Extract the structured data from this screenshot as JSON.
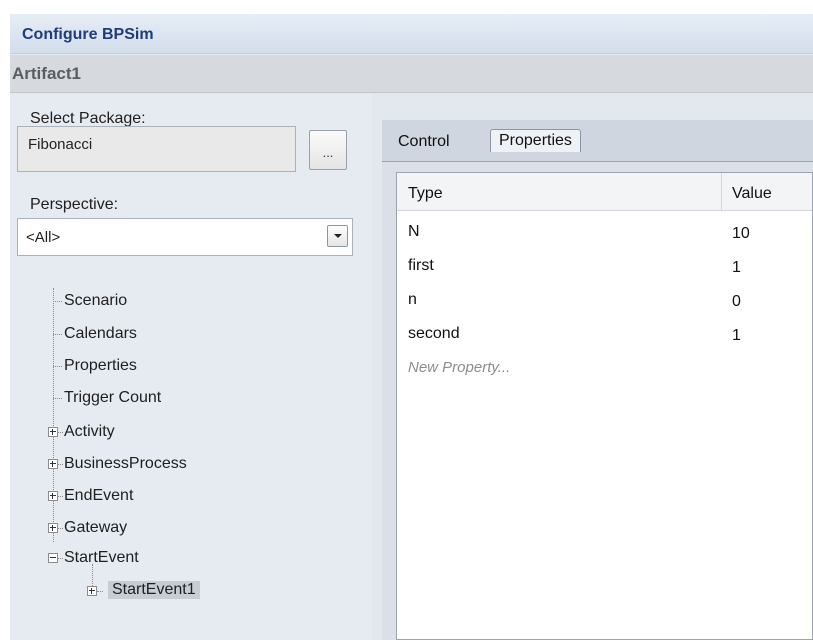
{
  "window": {
    "title": "Configure BPSim",
    "subtitle": "Artifact1"
  },
  "left": {
    "select_package_label": "Select Package:",
    "package_value": "Fibonacci",
    "browse_label": "...",
    "perspective_label": "Perspective:",
    "perspective_value": "<All>",
    "tree": {
      "leaf_items": [
        "Scenario",
        "Calendars",
        "Properties",
        "Trigger Count"
      ],
      "group_items": [
        "Activity",
        "BusinessProcess",
        "EndEvent",
        "Gateway",
        "StartEvent"
      ],
      "child_item": "StartEvent1"
    }
  },
  "right": {
    "tabs": [
      "Control",
      "Properties"
    ],
    "active_tab": "Properties",
    "grid": {
      "columns": [
        "Type",
        "Value"
      ],
      "rows": [
        {
          "type": "N",
          "value": "10"
        },
        {
          "type": "first",
          "value": "1"
        },
        {
          "type": "n",
          "value": "0"
        },
        {
          "type": "second",
          "value": "1"
        }
      ],
      "new_row_placeholder": "New Property..."
    }
  }
}
